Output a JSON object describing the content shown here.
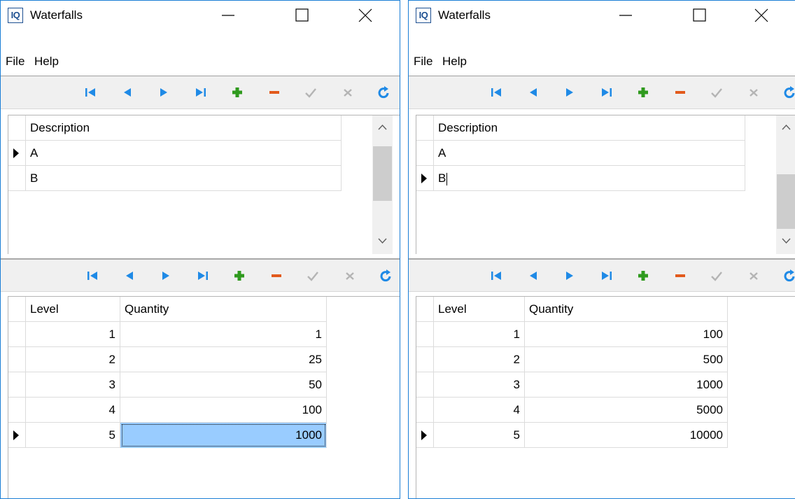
{
  "colors": {
    "accent": "#1a7ed6",
    "nav_blue": "#1f8ae6",
    "add_green": "#2f9a1e",
    "delete_red": "#e25a1c",
    "disabled_gray": "#b4b4b4",
    "selection": "#99ccff"
  },
  "navigator_icons": [
    "first-icon",
    "prior-icon",
    "next-icon",
    "last-icon",
    "insert-icon",
    "delete-icon",
    "post-icon",
    "cancel-icon",
    "refresh-icon"
  ],
  "windows": [
    {
      "app_icon_text": "IQ",
      "title": "Waterfalls",
      "menu": [
        "File",
        "Help"
      ],
      "master": {
        "header": "Description",
        "rows": [
          "A",
          "B"
        ],
        "current_row": 0
      },
      "detail": {
        "columns": [
          "Level",
          "Quantity"
        ],
        "rows": [
          {
            "level": "1",
            "quantity": "1"
          },
          {
            "level": "2",
            "quantity": "25"
          },
          {
            "level": "3",
            "quantity": "50"
          },
          {
            "level": "4",
            "quantity": "100"
          },
          {
            "level": "5",
            "quantity": "1000"
          }
        ],
        "current_row": 4
      }
    },
    {
      "app_icon_text": "IQ",
      "title": "Waterfalls",
      "menu": [
        "File",
        "Help"
      ],
      "master": {
        "header": "Description",
        "rows": [
          "A",
          "B"
        ],
        "current_row": 1
      },
      "detail": {
        "columns": [
          "Level",
          "Quantity"
        ],
        "rows": [
          {
            "level": "1",
            "quantity": "100"
          },
          {
            "level": "2",
            "quantity": "500"
          },
          {
            "level": "3",
            "quantity": "1000"
          },
          {
            "level": "4",
            "quantity": "5000"
          },
          {
            "level": "5",
            "quantity": "10000"
          }
        ],
        "current_row": 4
      }
    }
  ]
}
